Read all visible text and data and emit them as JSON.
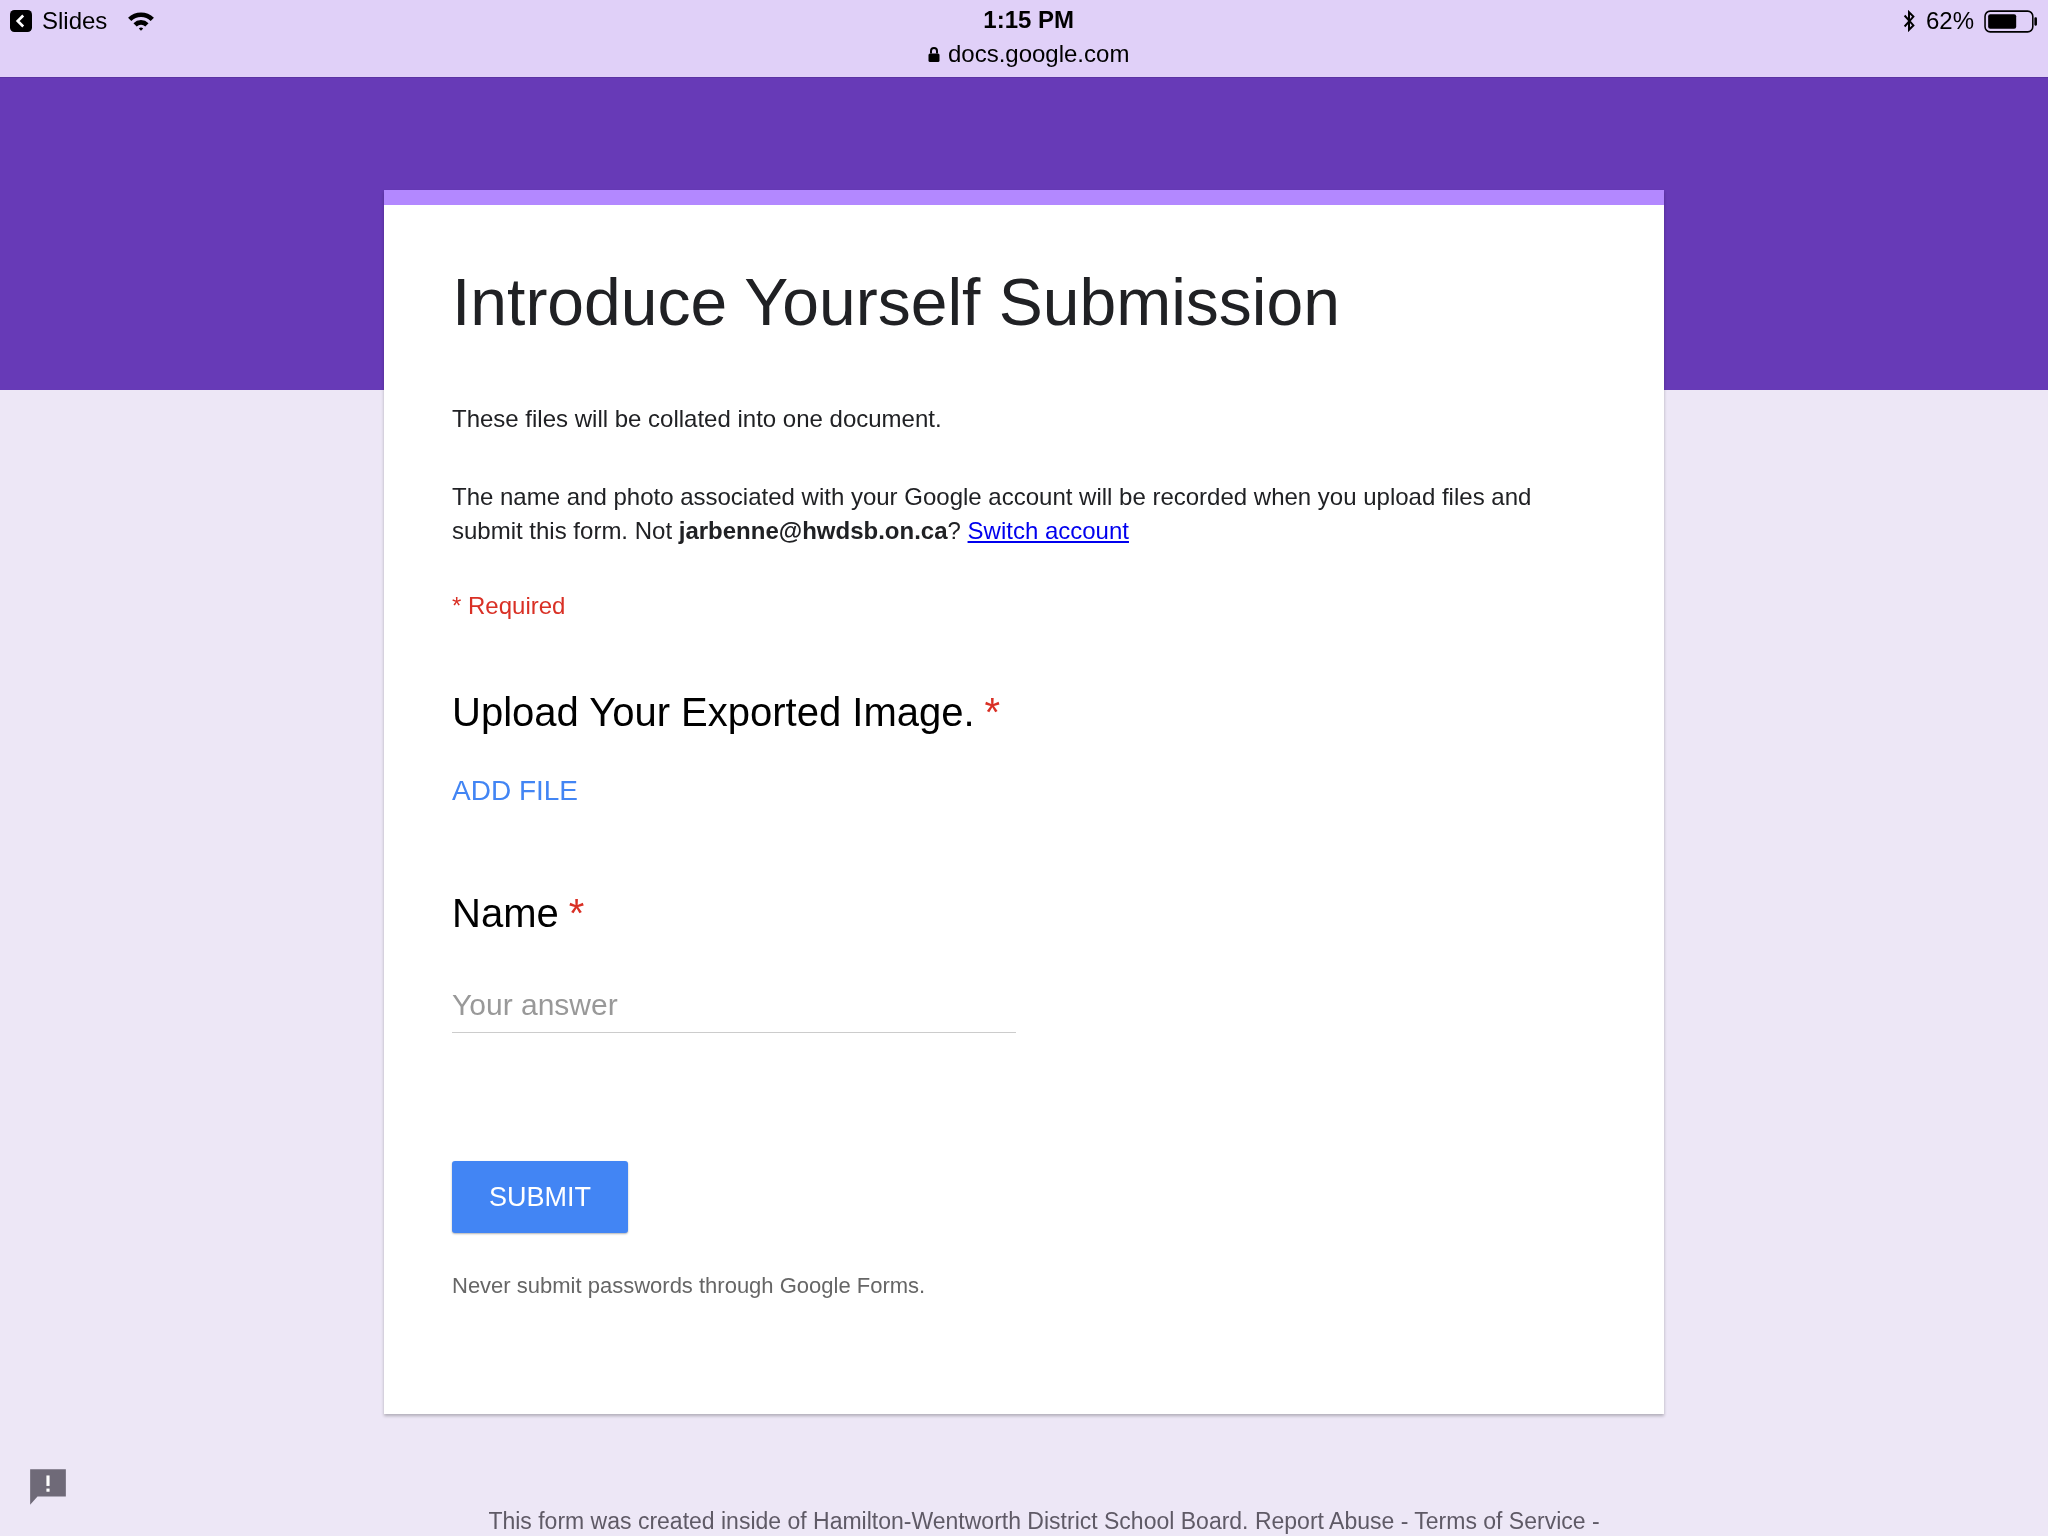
{
  "status_bar": {
    "back_app": "Slides",
    "time": "1:15 PM",
    "url": "docs.google.com",
    "battery": "62%"
  },
  "form": {
    "title": "Introduce Yourself Submission",
    "description": "These files will be collated into one document.",
    "account_notice": "The name and photo associated with your Google account will be recorded when you upload files and submit this form. Not **jarbenne@hwdsb.on.ca**?",
    "switch_link": "Switch account",
    "required_note": "* Required",
    "questions": [
      {
        "kind": "upload",
        "title": "Upload Your Exported Image.",
        "asterisk": "*",
        "action": "ADD FILE"
      },
      {
        "kind": "text",
        "title": "Name",
        "asterisk": "*",
        "placeholder": "Your answer"
      }
    ],
    "submit": "SUBMIT",
    "warning": "Never submit passwords through Google Forms."
  },
  "footer": "This form was created inside of Hamilton-Wentworth District School Board. Report Abuse - Terms of Service -"
}
